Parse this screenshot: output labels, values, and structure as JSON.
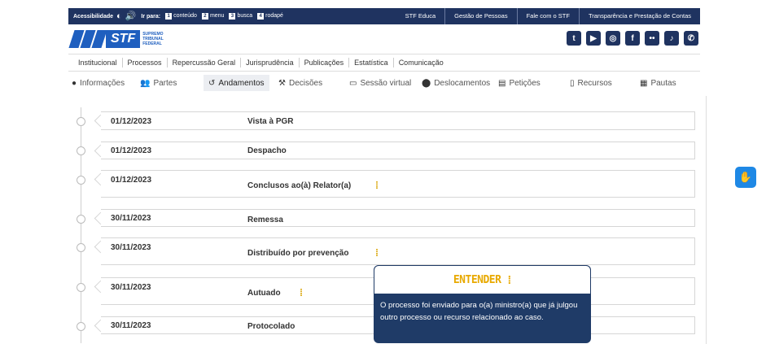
{
  "topbar": {
    "accessibility_label": "Acessibilidade",
    "jump_label": "Ir para:",
    "jump_links": [
      {
        "key": "1",
        "label": "conteúdo"
      },
      {
        "key": "2",
        "label": "menu"
      },
      {
        "key": "3",
        "label": "busca"
      },
      {
        "key": "4",
        "label": "rodapé"
      }
    ],
    "links": [
      "STF Educa",
      "Gestão de Pessoas",
      "Fale com o STF",
      "Transparência e Prestação de Contas"
    ]
  },
  "logo": {
    "short": "STF",
    "full": "SUPREMO TRIBUNAL FEDERAL"
  },
  "socials": [
    "twitter-icon",
    "youtube-icon",
    "instagram-icon",
    "facebook-icon",
    "flickr-icon",
    "tiktok-icon",
    "whatsapp-icon"
  ],
  "main_nav": [
    "Institucional",
    "Processos",
    "Repercussão Geral",
    "Jurisprudência",
    "Publicações",
    "Estatística",
    "Comunicação"
  ],
  "tabs": [
    {
      "label": "Informações",
      "icon": "info-icon"
    },
    {
      "label": "Partes",
      "icon": "users-icon"
    },
    {
      "label": "Andamentos",
      "icon": "history-icon",
      "active": true
    },
    {
      "label": "Decisões",
      "icon": "gavel-icon"
    },
    {
      "label": "Sessão virtual",
      "icon": "monitor-icon"
    },
    {
      "label": "Deslocamentos",
      "icon": "location-icon"
    },
    {
      "label": "Petições",
      "icon": "document-icon"
    },
    {
      "label": "Recursos",
      "icon": "file-icon"
    },
    {
      "label": "Pautas",
      "icon": "calendar-icon"
    }
  ],
  "timeline": [
    {
      "date": "01/12/2023",
      "description": "Vista à PGR",
      "has_info": false
    },
    {
      "date": "01/12/2023",
      "description": "Despacho",
      "has_info": false
    },
    {
      "date": "01/12/2023",
      "description": "Conclusos ao(à) Relator(a)",
      "has_info": true
    },
    {
      "date": "30/11/2023",
      "description": "Remessa",
      "has_info": false
    },
    {
      "date": "30/11/2023",
      "description": "Distribuído por prevenção",
      "has_info": true
    },
    {
      "date": "30/11/2023",
      "description": "Autuado",
      "has_info": true
    },
    {
      "date": "30/11/2023",
      "description": "Protocolado",
      "has_info": false
    }
  ],
  "tooltip": {
    "brand": "ENTENDER",
    "text": "O processo foi enviado para o(a) ministro(a) que já julgou outro processo ou recurso relacionado ao caso."
  },
  "colors": {
    "navy": "#1f3360",
    "brand_blue": "#1f5fbf",
    "accent_yellow": "#e8a900",
    "fab_blue": "#1e88e5"
  }
}
